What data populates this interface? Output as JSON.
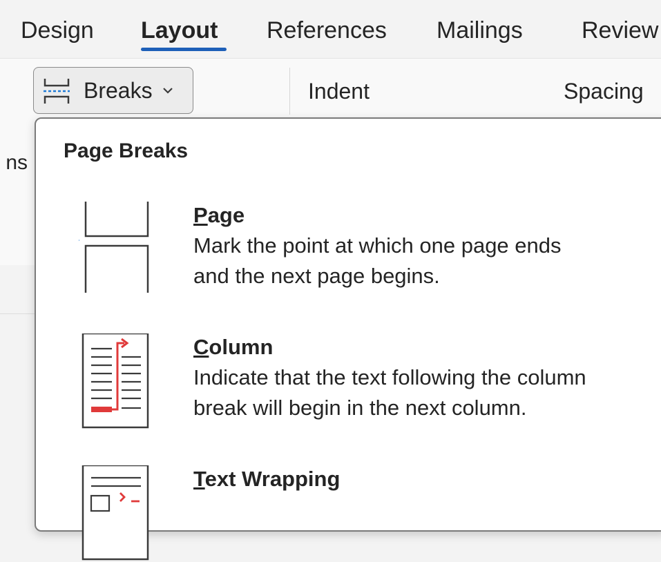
{
  "tabs": [
    {
      "label": "Design",
      "active": false
    },
    {
      "label": "Layout",
      "active": true
    },
    {
      "label": "References",
      "active": false
    },
    {
      "label": "Mailings",
      "active": false
    },
    {
      "label": "Review",
      "active": false
    }
  ],
  "ribbon": {
    "breaks_label": "Breaks",
    "indent_label": "Indent",
    "spacing_label": "Spacing",
    "cut_left_text": "ns"
  },
  "dropdown": {
    "section_heading": "Page Breaks",
    "items": [
      {
        "title_key": "P",
        "title_rest": "age",
        "desc_line1": "Mark the point at which one page ends",
        "desc_line2": "and the next page begins.",
        "icon": "page-break-icon"
      },
      {
        "title_key": "C",
        "title_rest": "olumn",
        "desc_line1": "Indicate that the text following the column",
        "desc_line2": "break will begin in the next column.",
        "icon": "column-break-icon"
      },
      {
        "title_key": "T",
        "title_rest": "ext Wrapping",
        "desc_line1": "",
        "desc_line2": "",
        "icon": "text-wrapping-break-icon"
      }
    ]
  },
  "colors": {
    "accent": "#1d5fb8",
    "break_red": "#e03a3a",
    "indicator_blue": "#1f7ad6"
  }
}
